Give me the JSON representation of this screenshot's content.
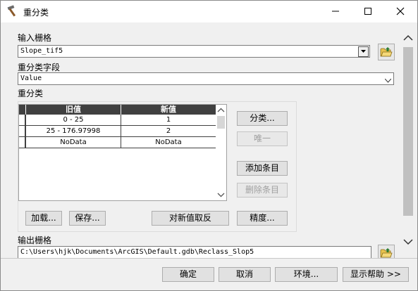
{
  "window": {
    "title": "重分类",
    "icon": "hammer-icon"
  },
  "input_raster": {
    "label": "输入栅格",
    "value": "Slope_tif5"
  },
  "reclass_field": {
    "label": "重分类字段",
    "value": "Value"
  },
  "reclassification": {
    "label": "重分类",
    "columns": [
      "旧值",
      "新值"
    ],
    "rows": [
      [
        "0 - 25",
        "1"
      ],
      [
        "25 - 176.97998",
        "2"
      ],
      [
        "NoData",
        "NoData"
      ]
    ],
    "buttons": {
      "classify": "分类...",
      "unique": "唯一",
      "add_entry": "添加条目",
      "delete_entry": "删除条目",
      "load": "加载...",
      "save": "保存...",
      "reverse": "对新值取反",
      "precision": "精度..."
    }
  },
  "output_raster": {
    "label": "输出栅格",
    "value": "C:\\Users\\hjk\\Documents\\ArcGIS\\Default.gdb\\Reclass_Slop5"
  },
  "footer": {
    "ok": "确定",
    "cancel": "取消",
    "environments": "环境...",
    "show_help": "显示帮助 >>"
  }
}
